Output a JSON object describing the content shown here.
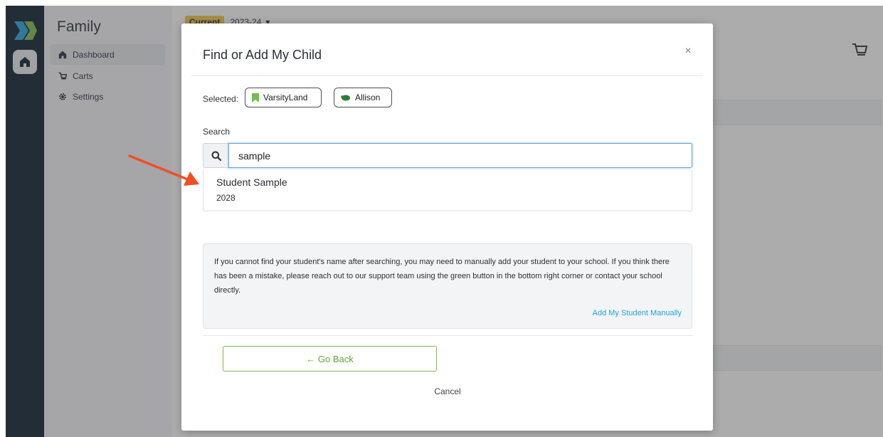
{
  "sidebar": {
    "title": "Family",
    "items": [
      {
        "label": "Dashboard",
        "icon": "home-icon"
      },
      {
        "label": "Carts",
        "icon": "cart-icon"
      },
      {
        "label": "Settings",
        "icon": "gear-icon"
      }
    ]
  },
  "header": {
    "season_badge": "Current",
    "season": "2023-24"
  },
  "modal": {
    "title": "Find or Add My Child",
    "close": "×",
    "selected_label": "Selected:",
    "chips": [
      {
        "label": "VarsityLand",
        "icon": "bookmark-icon",
        "color": "#6fbf4a"
      },
      {
        "label": "Allison",
        "icon": "mascot-icon",
        "color": "#2e7d32"
      }
    ],
    "search_label": "Search",
    "search_value": "sample",
    "results": [
      {
        "name": "Student Sample",
        "year": "2028"
      }
    ],
    "info_text": "If you cannot find your student's name after searching, you may need to manually add your student to your school. If you think there has been a mistake, please reach out to our support team using the green button in the bottom right corner or contact your school directly.",
    "add_manual": "Add My Student Manually",
    "back_button": "← Go Back",
    "cancel": "Cancel"
  },
  "colors": {
    "accent_green": "#7dbb45",
    "link_blue": "#1fa3e0",
    "rail": "#07182a",
    "annotation_arrow": "#f04e23"
  }
}
